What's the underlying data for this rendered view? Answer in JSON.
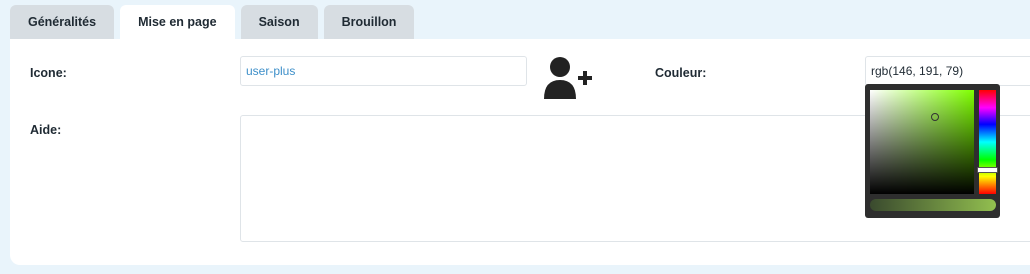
{
  "tabs": [
    {
      "label": "Généralités",
      "active": false
    },
    {
      "label": "Mise en page",
      "active": true
    },
    {
      "label": "Saison",
      "active": false
    },
    {
      "label": "Brouillon",
      "active": false
    }
  ],
  "form": {
    "icon_label": "Icone:",
    "icon_value": "user-plus",
    "icon_preview": "user-plus-icon",
    "color_label": "Couleur:",
    "color_value": "rgb(146, 191, 79)",
    "help_label": "Aide:",
    "help_value": ""
  },
  "color_picker": {
    "selected_color": "#92bf4f",
    "hue_color": "#7fff00"
  }
}
